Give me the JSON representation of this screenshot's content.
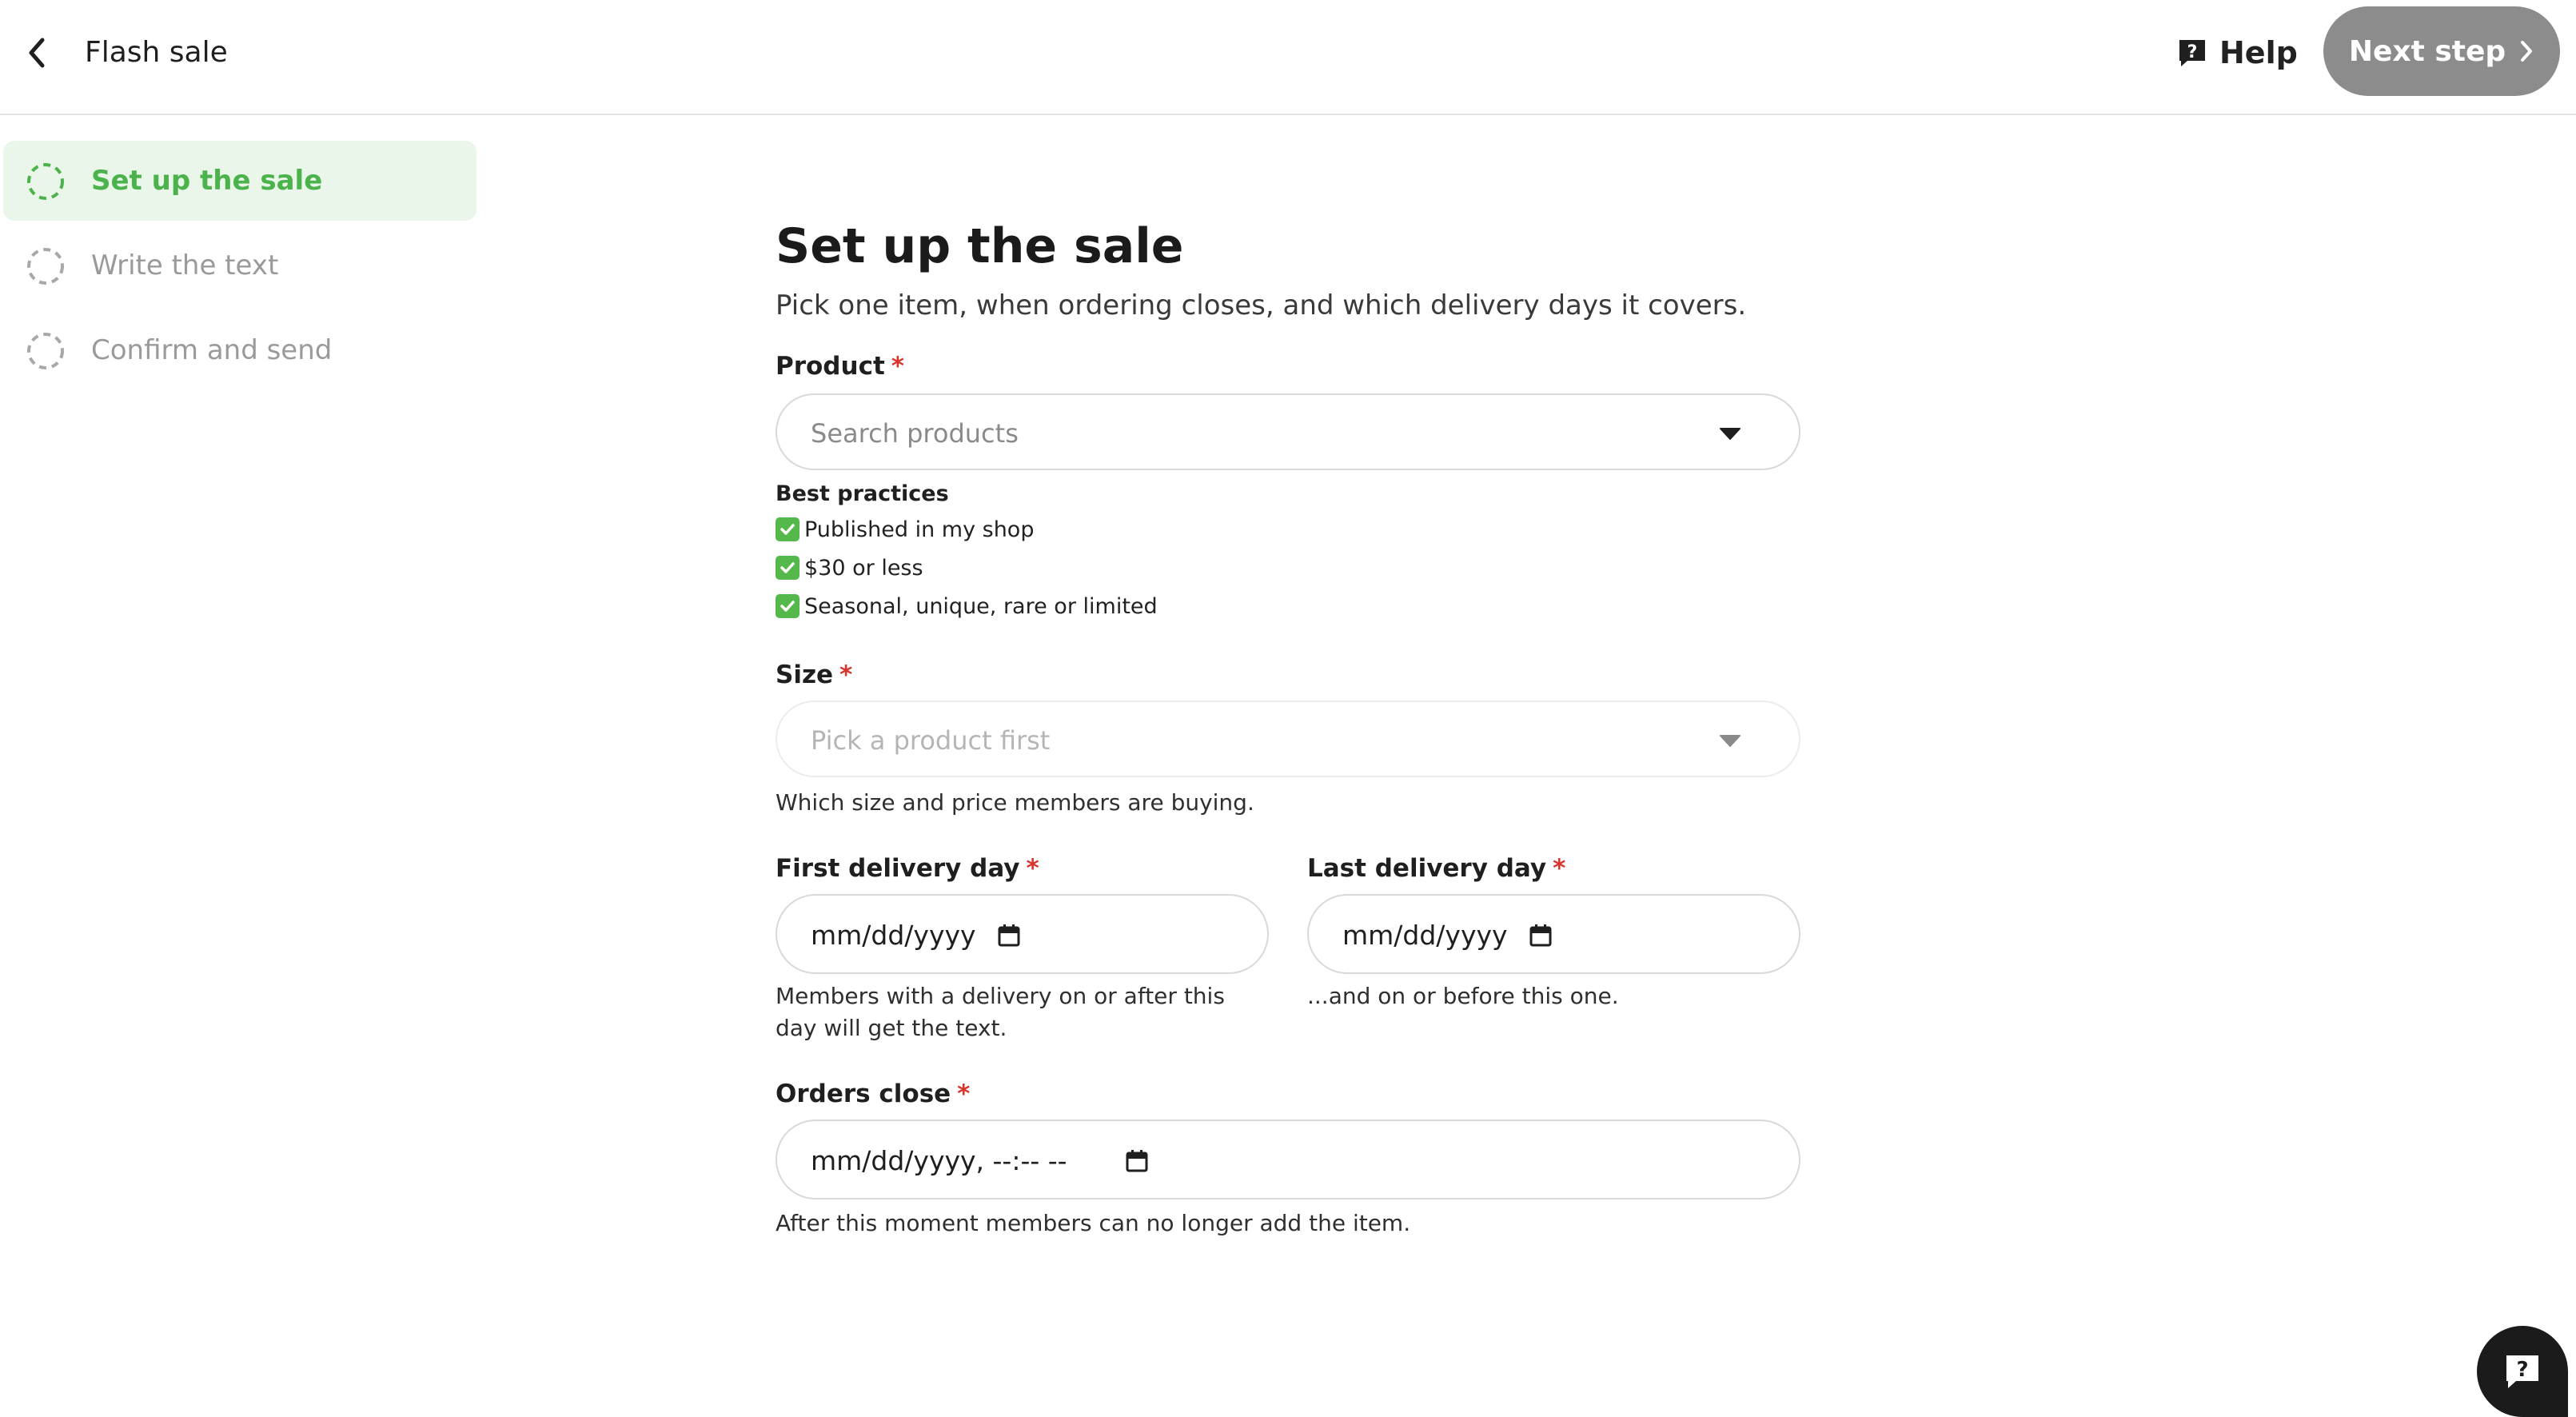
{
  "header": {
    "title": "Flash sale",
    "help_label": "Help",
    "next_label": "Next step"
  },
  "sidebar": {
    "steps": [
      {
        "label": "Set up the sale",
        "active": true
      },
      {
        "label": "Write the text",
        "active": false
      },
      {
        "label": "Confirm and send",
        "active": false
      }
    ]
  },
  "form": {
    "title": "Set up the sale",
    "subtitle": "Pick one item, when ordering closes, and which delivery days it covers.",
    "product": {
      "label": "Product",
      "required_mark": "*",
      "placeholder": "Search products"
    },
    "best_practices": {
      "title": "Best practices",
      "items": [
        "Published in my shop",
        "$30 or less",
        "Seasonal, unique, rare or limited"
      ]
    },
    "size": {
      "label": "Size",
      "required_mark": "*",
      "placeholder": "Pick a product first",
      "hint": "Which size and price members are buying."
    },
    "first_delivery": {
      "label": "First delivery day",
      "required_mark": "*",
      "value": "mm/dd/yyyy",
      "hint": "Members with a delivery on or after this day will get the text."
    },
    "last_delivery": {
      "label": "Last delivery day",
      "required_mark": "*",
      "value": "mm/dd/yyyy",
      "hint": "...and on or before this one."
    },
    "orders_close": {
      "label": "Orders close",
      "required_mark": "*",
      "value": "mm/dd/yyyy, --:-- --",
      "hint": "After this moment members can no longer add the item."
    }
  },
  "colors": {
    "accent_green": "#4cb34c",
    "active_step_bg": "#e9f6e9",
    "next_button_bg": "#8c8c8c",
    "required_red": "#d9342b"
  }
}
